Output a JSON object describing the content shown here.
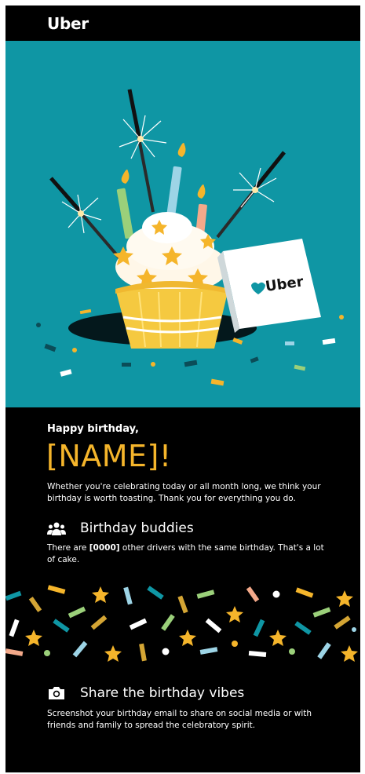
{
  "header": {
    "logo": "Uber"
  },
  "hero": {
    "card_logo": "Uber",
    "card_icon": "heart-icon"
  },
  "greeting": {
    "small": "Happy birthday,",
    "name": "[NAME]!",
    "body": "Whether you're celebrating today or all month long, we think your birthday is worth toasting. Thank you for everything you do."
  },
  "buddies": {
    "icon": "people-icon",
    "title": "Birthday buddies",
    "body_prefix": "There are ",
    "count": "[0000]",
    "body_suffix": " other drivers with the same birthday. That's a lot of cake."
  },
  "share": {
    "icon": "camera-icon",
    "title": "Share the birthday vibes",
    "body": "Screenshot your birthday email to share on social media or with friends and family to spread the celebratory spirit."
  },
  "colors": {
    "teal": "#0f96a4",
    "gold": "#f5b52b",
    "black": "#000000"
  }
}
